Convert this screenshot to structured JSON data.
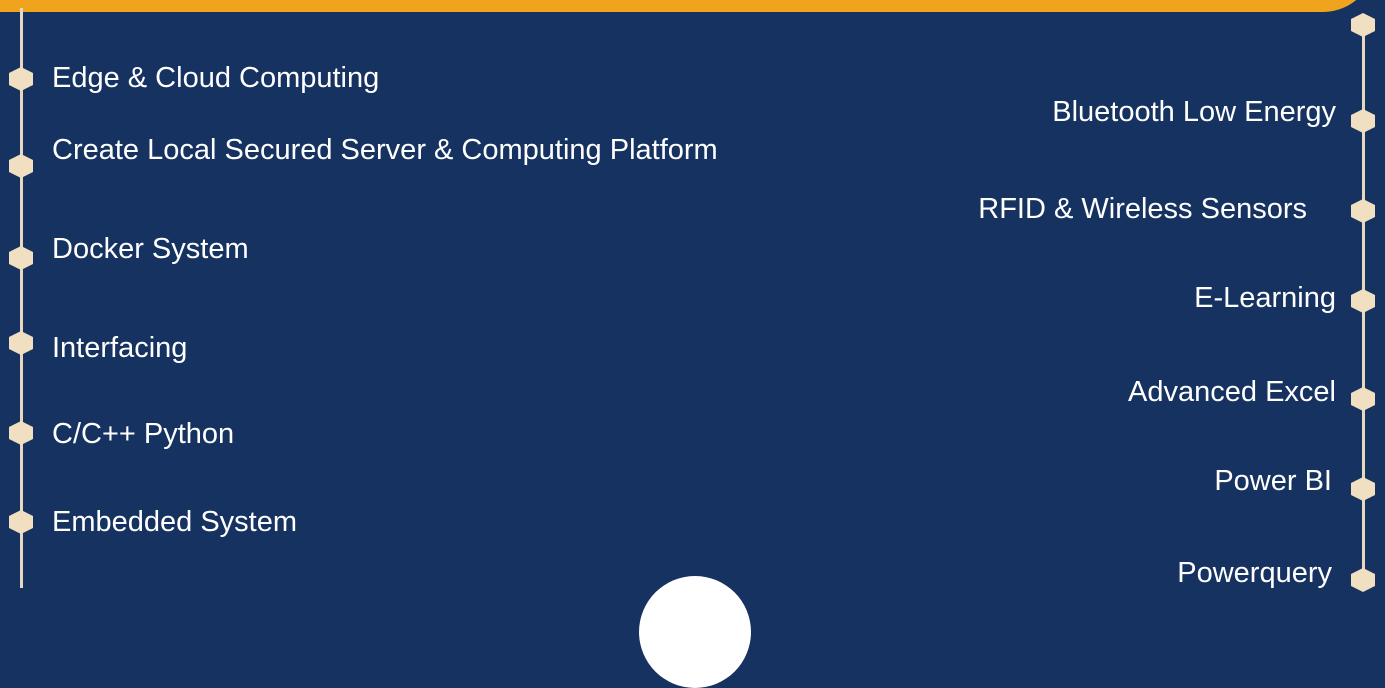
{
  "colors": {
    "background": "#163260",
    "accent_bar": "#f0a31c",
    "node": "#f0dfc0",
    "text": "#ffffff"
  },
  "left_list": {
    "items": [
      {
        "label": "Edge & Cloud Computing"
      },
      {
        "label": "Create Local Secured Server & Computing Platform"
      },
      {
        "label": "Docker System"
      },
      {
        "label": "Interfacing"
      },
      {
        "label": "C/C++ Python"
      },
      {
        "label": "Embedded System"
      }
    ]
  },
  "right_list": {
    "items": [
      {
        "label": "Bluetooth Low Energy"
      },
      {
        "label": "RFID & Wireless Sensors"
      },
      {
        "label": "E-Learning"
      },
      {
        "label": "Advanced Excel"
      },
      {
        "label": "Power BI"
      },
      {
        "label": "Powerquery"
      }
    ]
  },
  "icons": {
    "node": "hexagon-node-icon"
  }
}
